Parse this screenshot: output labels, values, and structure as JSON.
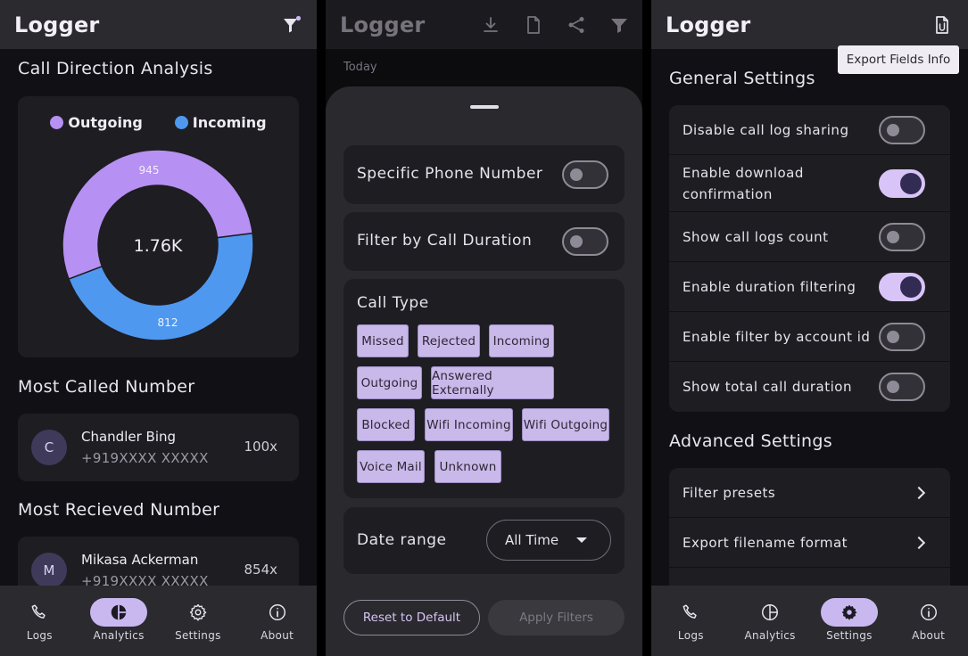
{
  "app_title": "Logger",
  "analytics": {
    "section1_title": "Call Direction Analysis",
    "legend": [
      {
        "label": "Outgoing",
        "color": "#b690f2"
      },
      {
        "label": "Incoming",
        "color": "#4f98ef"
      }
    ],
    "center_total": "1.76K",
    "outgoing_value": "945",
    "incoming_value": "812",
    "most_called_title": "Most Called Number",
    "most_called": {
      "initial": "C",
      "name": "Chandler Bing",
      "number": "+919XXXX XXXXX",
      "count": "100x"
    },
    "most_received_title": "Most Recieved Number",
    "most_received": {
      "initial": "M",
      "name": "Mikasa Ackerman",
      "number": "+919XXXX XXXXX",
      "count": "854x"
    }
  },
  "chart_data": {
    "type": "pie",
    "categories": [
      "Outgoing",
      "Incoming"
    ],
    "values": [
      945,
      812
    ],
    "colors": [
      "#b690f2",
      "#4f98ef"
    ],
    "total_label": "1.76K",
    "legend_placement": "top"
  },
  "nav": {
    "items": [
      "Logs",
      "Analytics",
      "Settings",
      "About"
    ]
  },
  "filters": {
    "today_label": "Today",
    "specific_phone_label": "Specific Phone Number",
    "duration_label": "Filter by Call Duration",
    "call_type_label": "Call Type",
    "call_types": [
      "Missed",
      "Rejected",
      "Incoming",
      "Outgoing",
      "Answered Externally",
      "Blocked",
      "Wifi Incoming",
      "Wifi Outgoing",
      "Voice Mail",
      "Unknown"
    ],
    "date_range_label": "Date range",
    "date_range_value": "All Time",
    "reset_label": "Reset to Default",
    "apply_label": "Apply Filters"
  },
  "settings": {
    "tooltip": "Export Fields Info",
    "general_title": "General Settings",
    "general_items": [
      {
        "label": "Disable call log sharing",
        "on": false
      },
      {
        "label": "Enable download confirmation",
        "on": true
      },
      {
        "label": "Show call logs count",
        "on": false
      },
      {
        "label": "Enable duration filtering",
        "on": true
      },
      {
        "label": "Enable filter by account id",
        "on": false
      },
      {
        "label": "Show total call duration",
        "on": false
      }
    ],
    "advanced_title": "Advanced Settings",
    "advanced_items": [
      "Filter presets",
      "Export filename format"
    ]
  },
  "colors": {
    "accent": "#c9b8f0",
    "outgoing": "#b690f2",
    "incoming": "#4f98ef"
  }
}
